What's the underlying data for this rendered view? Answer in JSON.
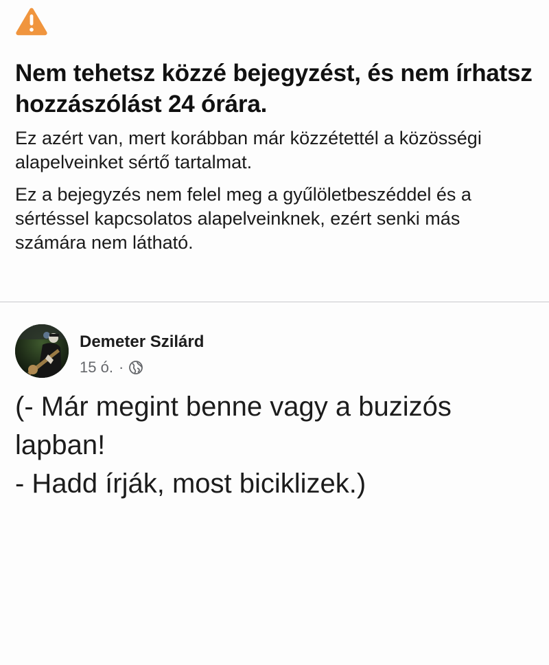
{
  "notice": {
    "icon": "warning-triangle-icon",
    "icon_color": "#f0953e",
    "title": "Nem tehetsz közzé bejegyzést, és nem írhatsz hozzászólást 24 órára.",
    "paragraph_1": "Ez azért van, mert korábban már közzétettél a közösségi alapelveinket sértő tartalmat.",
    "paragraph_2": "Ez a bejegyzés nem felel meg a gyűlöletbeszéddel és a sértéssel kapcsolatos alapelveinknek, ezért senki más számára nem látható."
  },
  "post": {
    "author": "Demeter Szilárd",
    "time": "15 ó.",
    "separator": "·",
    "audience_icon": "globe-icon",
    "lines": [
      "(- Már megint benne vagy a buzizós",
      "lapban!",
      "- Hadd írják, most biciklizek.)"
    ]
  }
}
